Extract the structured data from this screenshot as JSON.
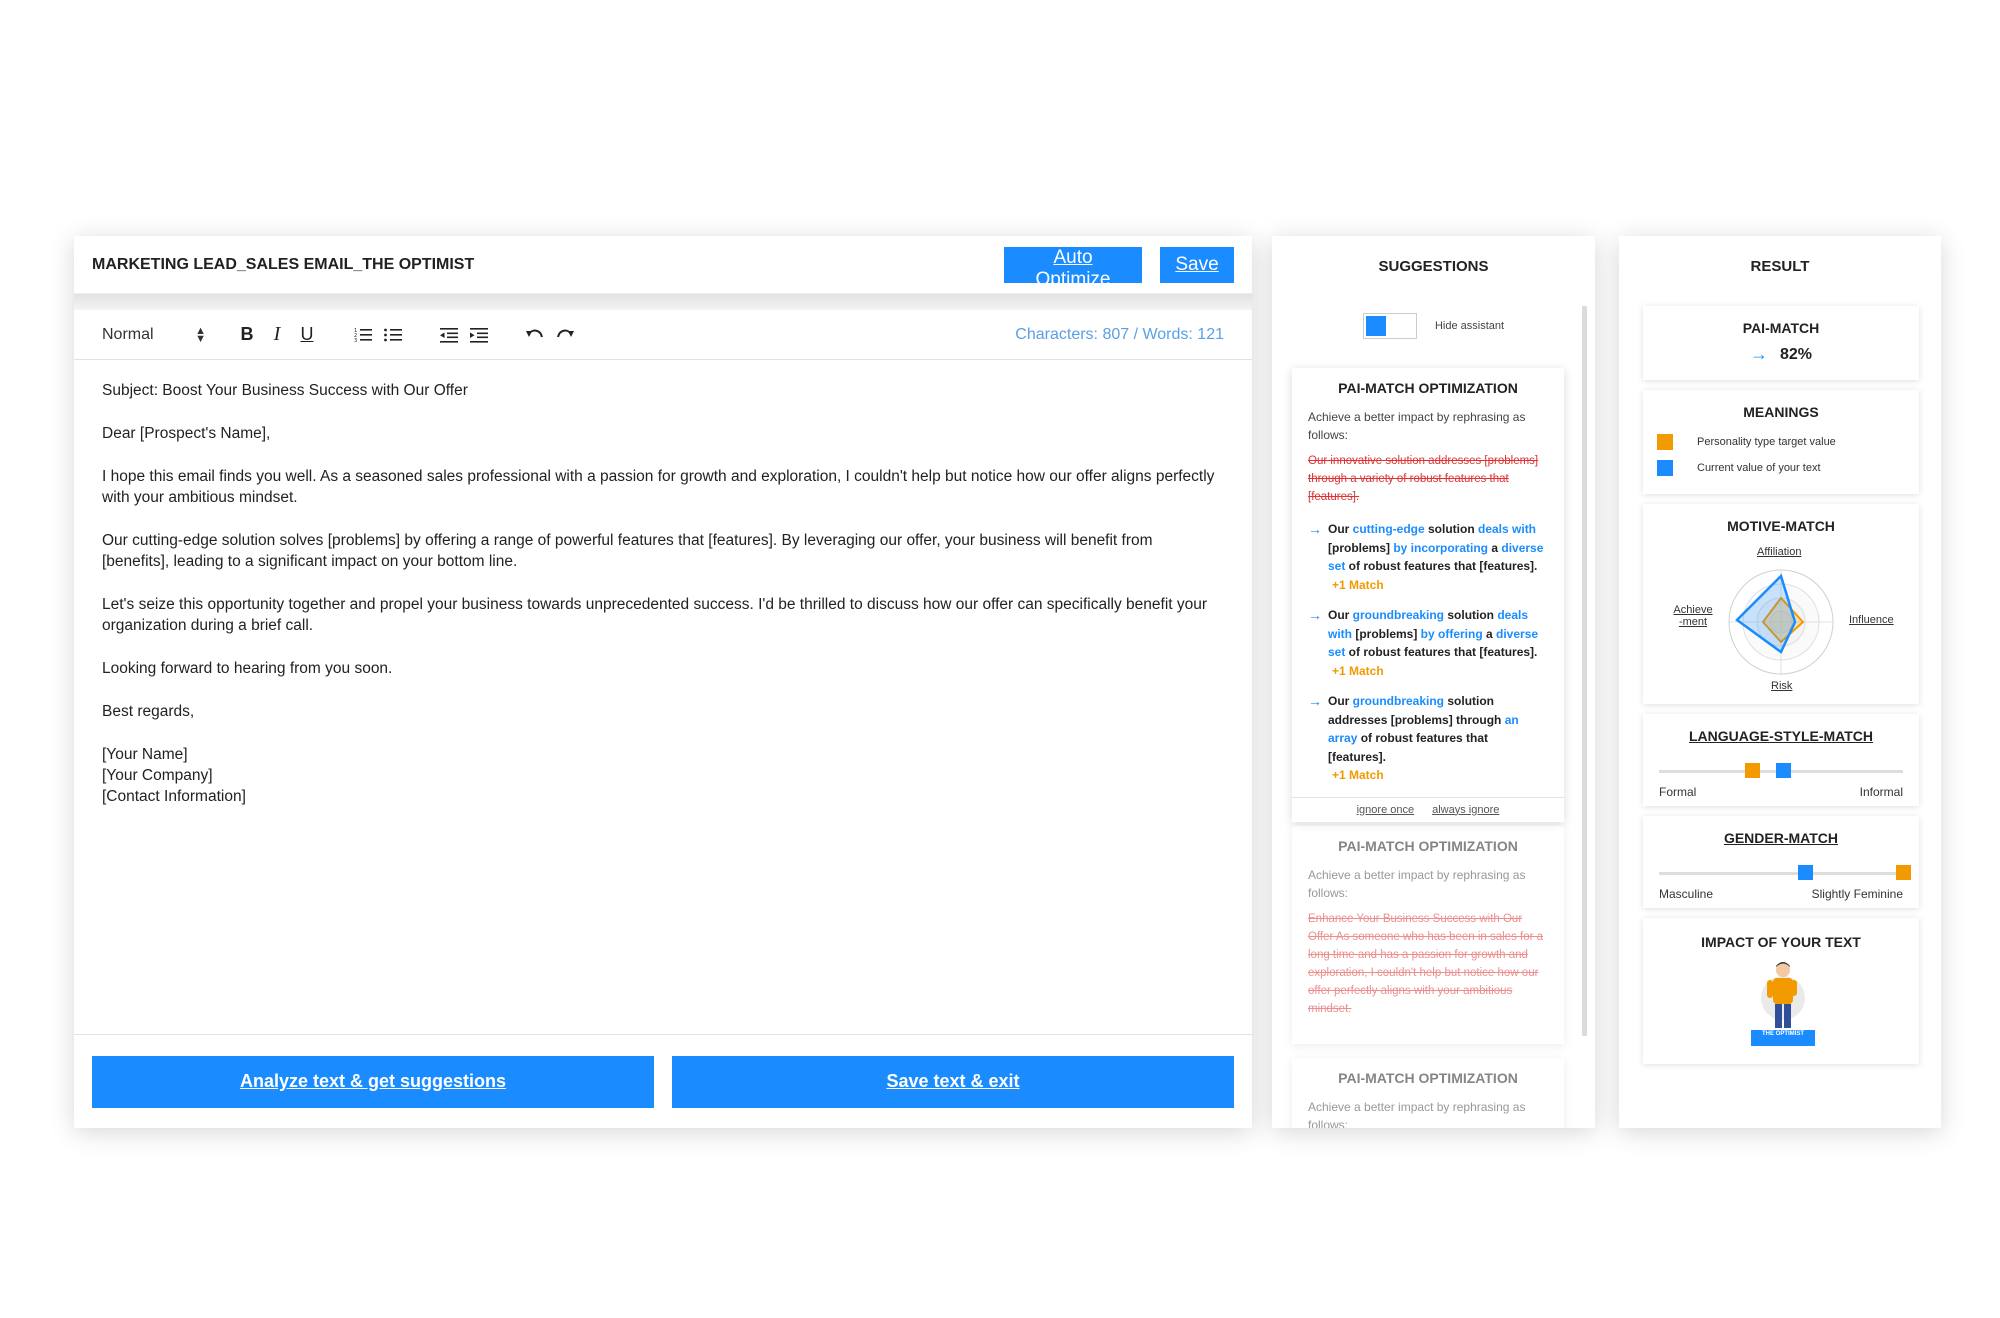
{
  "editor": {
    "title": "MARKETING LEAD_SALES EMAIL_THE OPTIMIST",
    "auto_optimize_label": "Auto Optimize",
    "save_label": "Save",
    "format_value": "Normal",
    "counts": "Characters: 807 / Words: 121",
    "paragraphs": [
      "Subject: Boost Your Business Success with Our Offer",
      "Dear [Prospect's Name],",
      "I hope this email finds you well. As a seasoned sales professional with a passion for growth and exploration, I couldn't help but notice how our offer aligns perfectly with your ambitious mindset.",
      "Our cutting-edge solution solves [problems] by offering a range of powerful features that [features]. By leveraging our offer, your business will benefit from [benefits], leading to a significant impact on your bottom line.",
      "Let's seize this opportunity together and propel your business towards unprecedented success. I'd be thrilled to discuss how our offer can specifically benefit your organization during a brief call.",
      "Looking forward to hearing from you soon.",
      "Best regards,"
    ],
    "signature": [
      "[Your Name]",
      "[Your Company]",
      "[Contact Information]"
    ],
    "analyze_label": "Analyze text & get suggestions",
    "save_exit_label": "Save text & exit"
  },
  "suggestions": {
    "title": "SUGGESTIONS",
    "toggle_label": "Hide assistant",
    "card1": {
      "title": "PAI-MATCH OPTIMIZATION",
      "desc": "Achieve a better impact by rephrasing as follows:",
      "original": "Our innovative solution addresses [problems] through a variety of robust features that [features].",
      "alt1": {
        "p1": "Our ",
        "h1": "cutting-edge",
        "p2": " solution ",
        "h2": "deals with",
        "p3": " [problems] ",
        "h3": "by incorporating",
        "p4": " a ",
        "h4": "diverse set",
        "p5": " of robust features that [features].",
        "match": "+1 Match"
      },
      "alt2": {
        "p1": "Our ",
        "h1": "groundbreaking",
        "p2": " solution ",
        "h2": "deals with",
        "p3": " [problems] ",
        "h3": "by offering",
        "p4": " a ",
        "h4": "diverse set",
        "p5": " of robust features that [features].",
        "match": "+1 Match"
      },
      "alt3": {
        "p1": "Our ",
        "h1": "groundbreaking",
        "p2": " solution addresses [problems] through ",
        "h2": "an array",
        "p3": " of robust features that [features].",
        "match": "+1 Match"
      },
      "ignore_once": "ignore once",
      "always_ignore": "always ignore"
    },
    "card2": {
      "title": "PAI-MATCH OPTIMIZATION",
      "desc": "Achieve a better impact by rephrasing as follows:",
      "original": "Enhance Your Business Success with Our Offer As someone who has been in sales for a long time and has a passion for growth and exploration, I couldn't help but notice how our offer perfectly aligns with your ambitious mindset."
    },
    "card3": {
      "title": "PAI-MATCH OPTIMIZATION",
      "desc": "Achieve a better impact by rephrasing as follows:"
    }
  },
  "result": {
    "title": "RESULT",
    "pai_match": {
      "title": "PAI-MATCH",
      "value": "82%"
    },
    "meanings": {
      "title": "MEANINGS",
      "target_label": "Personality type target value",
      "current_label": "Current value of your text",
      "target_color": "#f29a00",
      "current_color": "#1a8cff"
    },
    "motive_match": {
      "title": "MOTIVE-MATCH",
      "axes": [
        "Affiliation",
        "Influence",
        "Risk",
        "Achieve -ment"
      ]
    },
    "language_style": {
      "title": "LANGUAGE-STYLE-MATCH",
      "left": "Formal",
      "right": "Informal",
      "target": 0.38,
      "current": 0.51
    },
    "gender_match": {
      "title": "GENDER-MATCH",
      "left": "Masculine",
      "right": "Slightly Feminine",
      "target": 1.0,
      "current": 0.6
    },
    "impact": {
      "title": "IMPACT OF YOUR TEXT",
      "badge": "THE OPTIMIST"
    }
  }
}
